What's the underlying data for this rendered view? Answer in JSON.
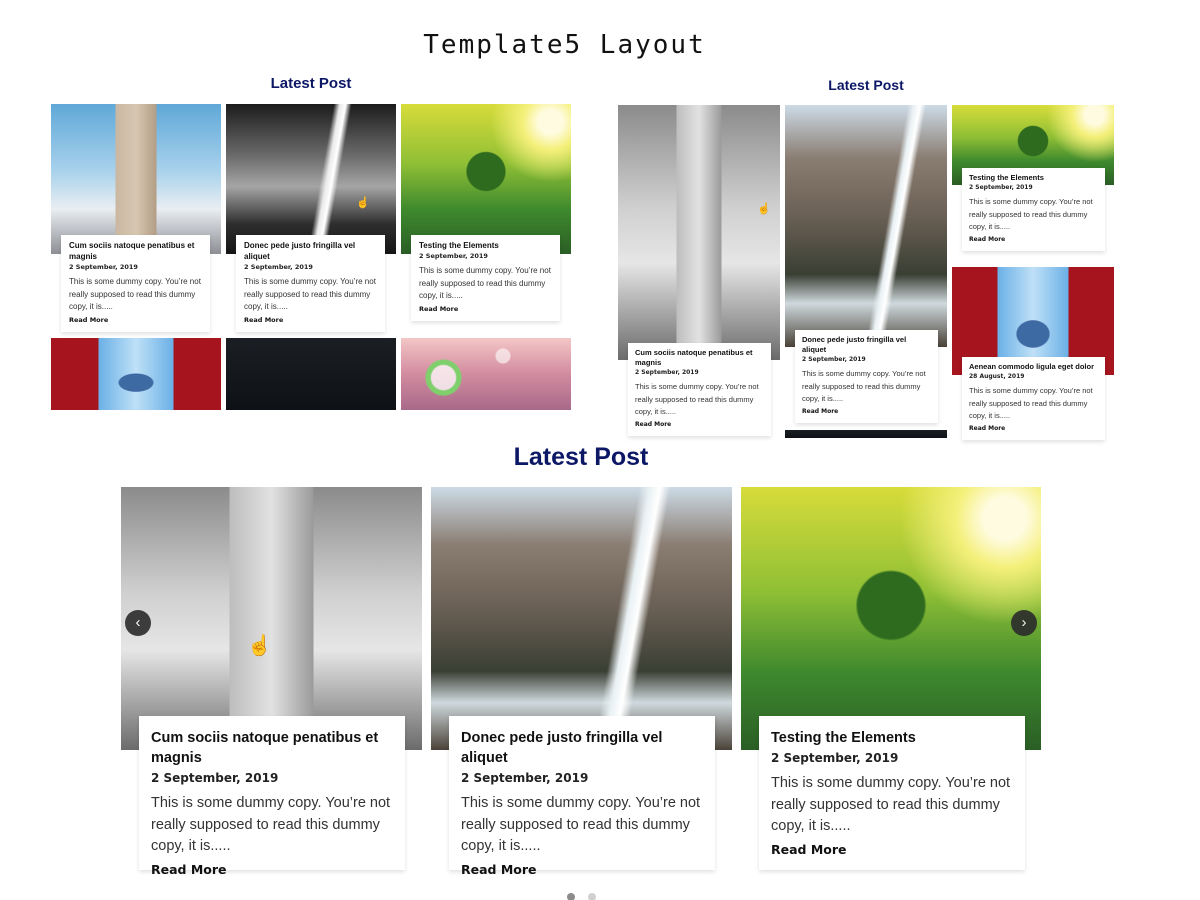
{
  "page": {
    "title": "Template5 Layout"
  },
  "sections": [
    {
      "heading": "Latest Post"
    },
    {
      "heading": "Latest Post"
    },
    {
      "heading": "Latest Post"
    }
  ],
  "posts": [
    {
      "title": "Cum sociis natoque penatibus et magnis",
      "date": "2 September, 2019",
      "excerpt": "This is some dummy copy. You’re not really supposed to read this dummy copy, it is.....",
      "read_more": "Read More"
    },
    {
      "title": "Donec pede justo fringilla vel aliquet",
      "date": "2 September, 2019",
      "excerpt": "This is some dummy copy. You’re not really supposed to read this dummy copy, it is.....",
      "read_more": "Read More"
    },
    {
      "title": "Testing the Elements",
      "date": "2 September, 2019",
      "excerpt": "This is some dummy copy. You’re not really supposed to read this dummy copy, it is.....",
      "read_more": "Read More"
    },
    {
      "title": "Aenean commodo ligula eget dolor",
      "date": "28 August, 2019",
      "excerpt": "This is some dummy copy. You’re not really supposed to read this dummy copy, it is.....",
      "read_more": "Read More"
    }
  ],
  "slider": {
    "prev_icon": "‹",
    "next_icon": "›",
    "dots": [
      {
        "active": true
      },
      {
        "active": false
      }
    ],
    "colors": {
      "dot_active": "#8c8c8c",
      "dot_inactive": "#d0d0d0",
      "heading": "#0c1766"
    }
  },
  "icons": {
    "cursor": "hand-pointer-icon"
  }
}
